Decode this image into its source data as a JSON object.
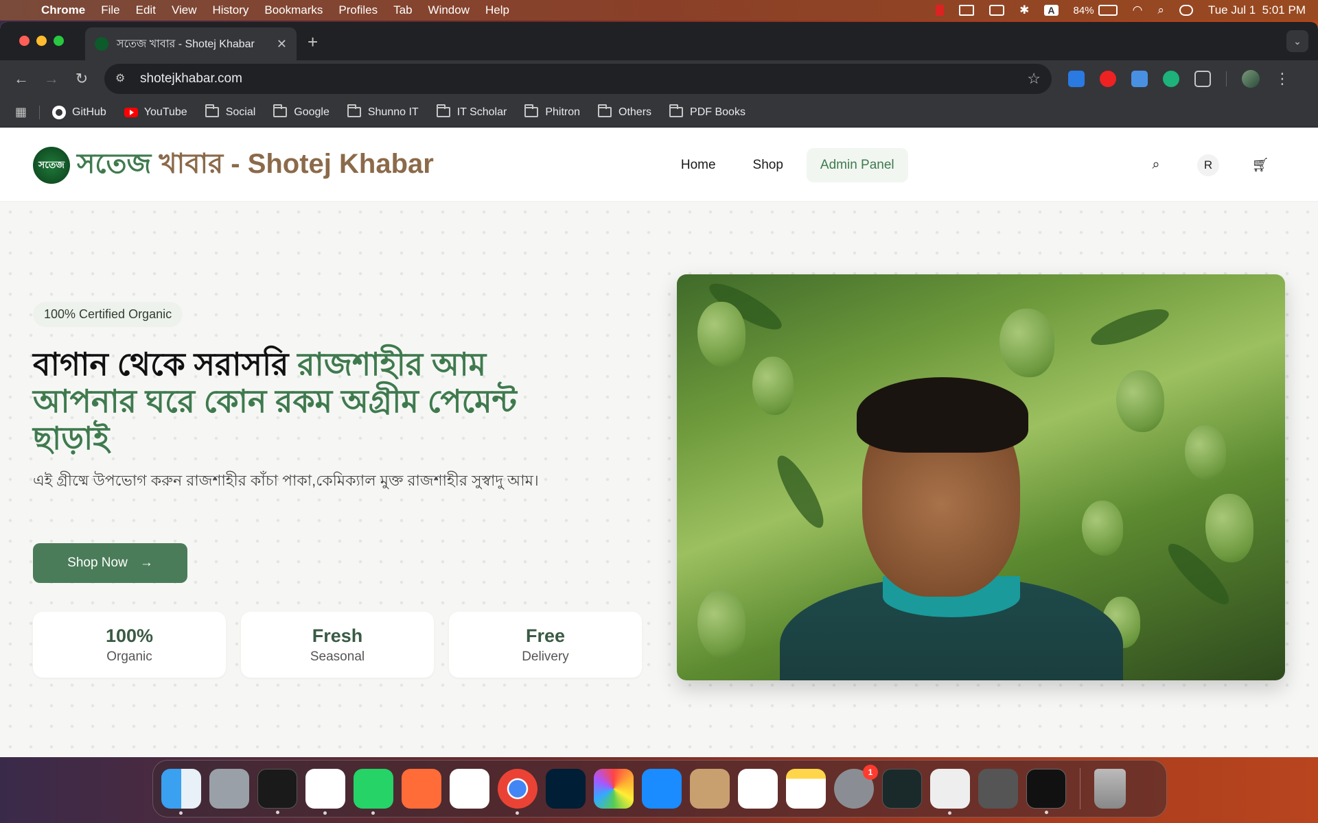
{
  "menubar": {
    "app": "Chrome",
    "items": [
      "File",
      "Edit",
      "View",
      "History",
      "Bookmarks",
      "Profiles",
      "Tab",
      "Window",
      "Help"
    ],
    "battery": "84%",
    "clock": "Tue Jul 1  5:01 PM",
    "input_badge": "A"
  },
  "browser": {
    "tab_title": "সতেজ খাবার - Shotej Khabar",
    "url": "shotejkhabar.com",
    "bookmarks": [
      "GitHub",
      "YouTube",
      "Social",
      "Google",
      "Shunno IT",
      "IT Scholar",
      "Phitron",
      "Others",
      "PDF Books"
    ]
  },
  "site": {
    "logo_text": "সতেজ",
    "brand_green": "সতেজ",
    "brand_rest": " খাবার - Shotej Khabar",
    "nav": {
      "home": "Home",
      "shop": "Shop",
      "admin": "Admin Panel"
    },
    "user_initial": "R",
    "hero": {
      "badge": "100% Certified Organic",
      "title_dark": "বাগান থেকে সরাসরি ",
      "title_green": "রাজশাহীর আম আপনার ঘরে কোন রকম অগ্রীম পেমেন্ট ছাড়াই",
      "subtitle": "এই গ্রীষ্মে উপভোগ করুন রাজশাহীর কাঁচা পাকা,কেমিক্যাল মুক্ত রাজশাহীর সুস্বাদু আম।",
      "cta": "Shop Now",
      "stats": [
        {
          "big": "100%",
          "small": "Organic"
        },
        {
          "big": "Fresh",
          "small": "Seasonal"
        },
        {
          "big": "Free",
          "small": "Delivery"
        }
      ]
    }
  },
  "dock": {
    "settings_badge": "1"
  },
  "colors": {
    "brand_green": "#3f7a4e",
    "brand_brown": "#8b6a4a",
    "button_green": "#4a7c59"
  }
}
